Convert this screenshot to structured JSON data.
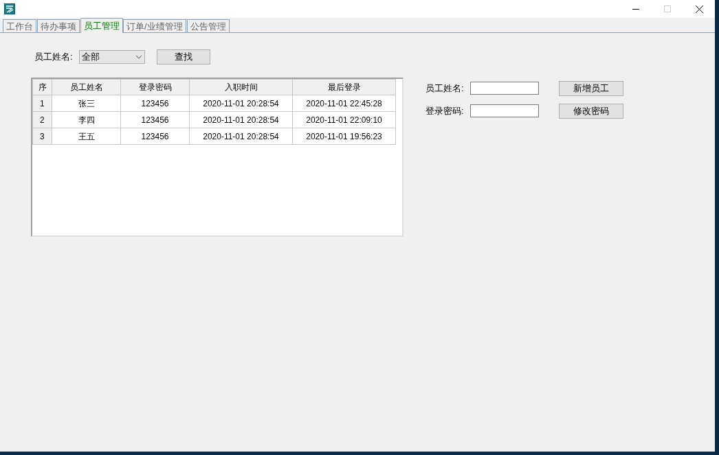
{
  "tabs": [
    {
      "label": "工作台",
      "selected": false
    },
    {
      "label": "待办事项",
      "selected": false
    },
    {
      "label": "员工管理",
      "selected": true
    },
    {
      "label": "订单/业绩管理",
      "selected": false
    },
    {
      "label": "公告管理",
      "selected": false
    }
  ],
  "filter": {
    "label": "员工姓名:",
    "value": "全部",
    "button": "查找"
  },
  "table": {
    "columns": [
      "序",
      "员工姓名",
      "登录密码",
      "入职时间",
      "最后登录"
    ],
    "rows": [
      [
        "1",
        "张三",
        "123456",
        "2020-11-01 20:28:54",
        "2020-11-01 22:45:28"
      ],
      [
        "2",
        "李四",
        "123456",
        "2020-11-01 20:28:54",
        "2020-11-01 22:09:10"
      ],
      [
        "3",
        "王五",
        "123456",
        "2020-11-01 20:28:54",
        "2020-11-01 19:56:23"
      ]
    ]
  },
  "form": {
    "fields": [
      {
        "label": "员工姓名:",
        "button": "新增员工"
      },
      {
        "label": "登录密码:",
        "button": "修改密码"
      }
    ]
  }
}
